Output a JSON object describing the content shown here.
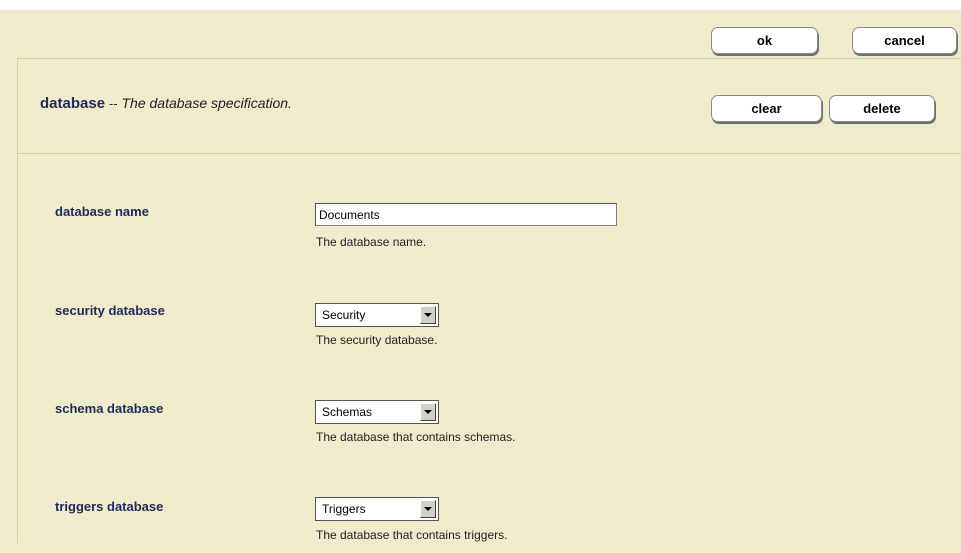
{
  "toolbar": {
    "ok_label": "ok",
    "cancel_label": "cancel",
    "clear_label": "clear",
    "delete_label": "delete"
  },
  "header": {
    "name": "database",
    "separator": "--",
    "description": "The database specification."
  },
  "fields": {
    "database_name": {
      "label": "database name",
      "value": "Documents",
      "help": "The database name."
    },
    "security_database": {
      "label": "security database",
      "value": "Security",
      "help": "The security database."
    },
    "schema_database": {
      "label": "schema database",
      "value": "Schemas",
      "help": "The database that contains schemas."
    },
    "triggers_database": {
      "label": "triggers database",
      "value": "Triggers",
      "help": "The database that contains triggers."
    }
  },
  "icons": {
    "dropdown": "chevron-down-icon"
  },
  "colors": {
    "panel_background": "#f1ebcd",
    "label_color": "#1f2a5a",
    "divider": "#d9cf9c"
  }
}
